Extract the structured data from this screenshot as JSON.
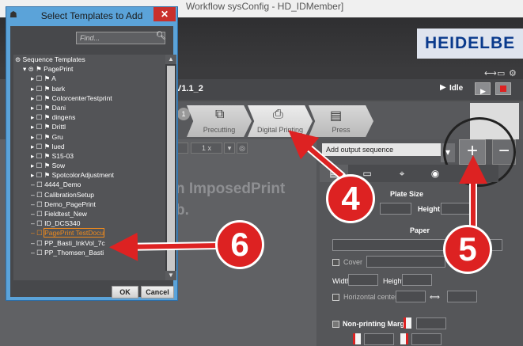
{
  "window": {
    "title_fragment": "Workflow   sysConfig - HD_IDMember]"
  },
  "brand": {
    "logo_text": "HEIDELBE"
  },
  "header": {
    "job_name": "V1.1_2",
    "status": "Idle"
  },
  "workflow_steps": [
    {
      "label": "Precutting"
    },
    {
      "label": "Digital Printing"
    },
    {
      "label": "Press"
    }
  ],
  "zoom": {
    "value": "1 x"
  },
  "left_panel": {
    "line1": "n ImposedPrint",
    "line2": "b."
  },
  "output": {
    "sequence_placeholder": "Add output sequence",
    "add_label": "+",
    "remove_label": "−",
    "plate_size_label": "Plate Size",
    "height_label": "Height",
    "paper_label": "Paper",
    "cover_label": "Cover",
    "width_label": "Width",
    "height2_label": "Height",
    "horizontal_center_label": "Horizontal center",
    "non_printing_margin_label": "Non-printing Margin"
  },
  "dialog": {
    "title": "Select Templates to Add",
    "close_label": "✕",
    "find_placeholder": "Find...",
    "ok_label": "OK",
    "cancel_label": "Cancel",
    "tree": [
      {
        "label": "Sequence Templates",
        "level": 0
      },
      {
        "label": "PagePrint",
        "level": 1
      },
      {
        "label": "A",
        "level": 2
      },
      {
        "label": "bark",
        "level": 2
      },
      {
        "label": "ColorcenterTestprint",
        "level": 2
      },
      {
        "label": "Dani",
        "level": 2
      },
      {
        "label": "dingens",
        "level": 2
      },
      {
        "label": "Drittl",
        "level": 2
      },
      {
        "label": "Gru",
        "level": 2
      },
      {
        "label": "lued",
        "level": 2
      },
      {
        "label": "S15-03",
        "level": 2
      },
      {
        "label": "Sow",
        "level": 2
      },
      {
        "label": "SpotcolorAdjustment",
        "level": 2
      },
      {
        "label": "4444_Demo",
        "level": 2
      },
      {
        "label": "CalibrationSetup",
        "level": 2
      },
      {
        "label": "Demo_PagePrint",
        "level": 2
      },
      {
        "label": "Fieldtest_New",
        "level": 2
      },
      {
        "label": "ID_DCS340",
        "level": 2
      },
      {
        "label": "PagePrint TestDocu",
        "level": 2,
        "selected": true
      },
      {
        "label": "PP_Basti_InkVol_7c",
        "level": 2
      },
      {
        "label": "PP_Thomsen_Basti",
        "level": 2
      }
    ]
  },
  "callouts": [
    {
      "number": "4"
    },
    {
      "number": "5"
    },
    {
      "number": "6"
    }
  ],
  "colors": {
    "accent_red": "#dd2222",
    "dialog_blue": "#5ba3d9",
    "selection_orange": "#f08a1c"
  }
}
